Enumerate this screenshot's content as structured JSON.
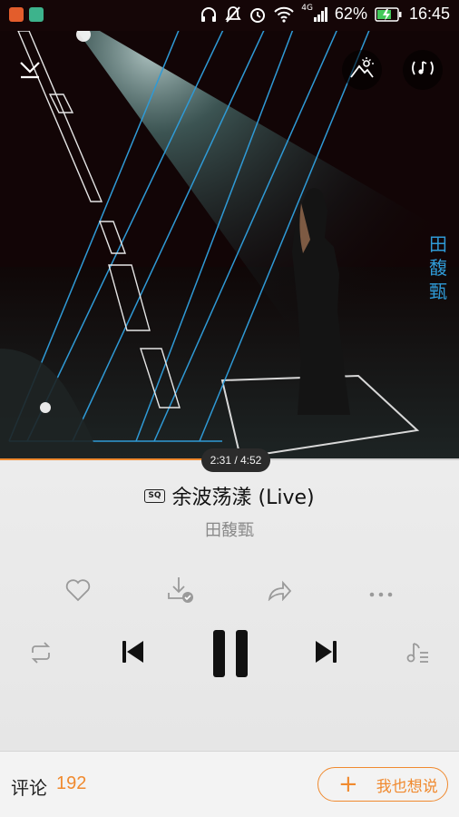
{
  "status_bar": {
    "network": "4G",
    "battery": "62%",
    "time": "16:45"
  },
  "album": {
    "artist_vertical": "田馥甄"
  },
  "playback": {
    "time_display": "2:31 / 4:52",
    "progress": 0.517
  },
  "song": {
    "quality_badge": "SQ",
    "title": "余波荡漾 (Live)",
    "artist": "田馥甄"
  },
  "footer": {
    "comment_label": "评论",
    "comment_count": "192",
    "want_say_label": "我也想说"
  },
  "colors": {
    "accent": "#f08a2f",
    "art_line": "#2f9ad6",
    "icon_gray": "#9a9a9a",
    "control_dark": "#111111"
  }
}
